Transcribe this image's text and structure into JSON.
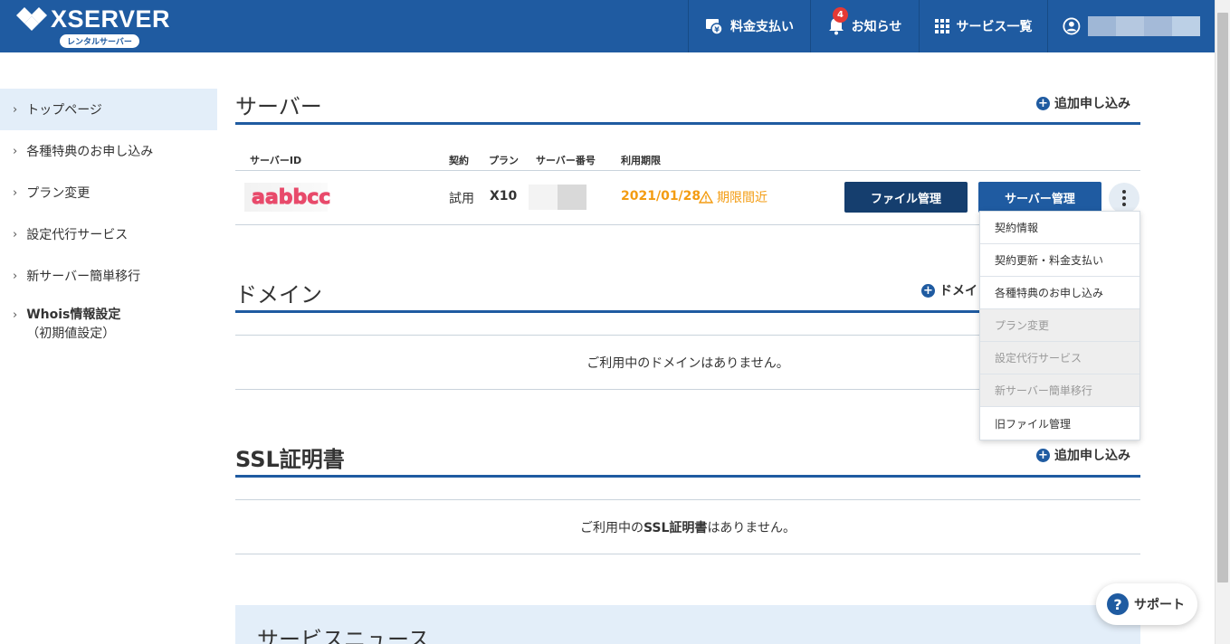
{
  "header": {
    "logo_text": "XSERVER",
    "logo_sub": "レンタルサーバー",
    "nav": {
      "payment": "料金支払い",
      "news": "お知らせ",
      "news_badge": "4",
      "services": "サービス一覧"
    }
  },
  "sidebar": {
    "items": [
      {
        "label": "トップページ"
      },
      {
        "label": "各種特典のお申し込み"
      },
      {
        "label": "プラン変更"
      },
      {
        "label": "設定代行サービス"
      },
      {
        "label": "新サーバー簡単移行"
      },
      {
        "label": "Whois情報設定",
        "sub": "（初期値設定）"
      }
    ]
  },
  "server": {
    "title": "サーバー",
    "add_label": "追加申し込み",
    "headers": {
      "id": "サーバーID",
      "contract": "契約",
      "plan": "プラン",
      "number": "サーバー番号",
      "expiry": "利用期限"
    },
    "row": {
      "id": "aabbcc",
      "contract": "試用",
      "plan": "X10",
      "expiry": "2021/01/28",
      "warning": "期限間近",
      "file_btn": "ファイル管理",
      "server_btn": "サーバー管理"
    }
  },
  "dropdown": {
    "items": [
      {
        "label": "契約情報",
        "disabled": false
      },
      {
        "label": "契約更新・料金支払い",
        "disabled": false
      },
      {
        "label": "各種特典のお申し込み",
        "disabled": false
      },
      {
        "label": "プラン変更",
        "disabled": true
      },
      {
        "label": "設定代行サービス",
        "disabled": true
      },
      {
        "label": "新サーバー簡単移行",
        "disabled": true
      },
      {
        "label": "旧ファイル管理",
        "disabled": false
      }
    ]
  },
  "domain": {
    "title": "ドメイン",
    "add_label_visible": "ドメイ",
    "empty": "ご利用中のドメインはありません。"
  },
  "ssl": {
    "title": "SSL証明書",
    "add_label": "追加申し込み",
    "empty_pre": "ご利用中の",
    "empty_bold": "SSL証明書",
    "empty_post": "はありません。"
  },
  "news": {
    "title": "サービスニュース"
  },
  "support": {
    "label": "サポート"
  },
  "colors": {
    "brand": "#1f5ba1",
    "brand_dark": "#153e6e",
    "warning": "#f39c12",
    "badge": "#e53935",
    "server_id": "#e84a6b"
  }
}
